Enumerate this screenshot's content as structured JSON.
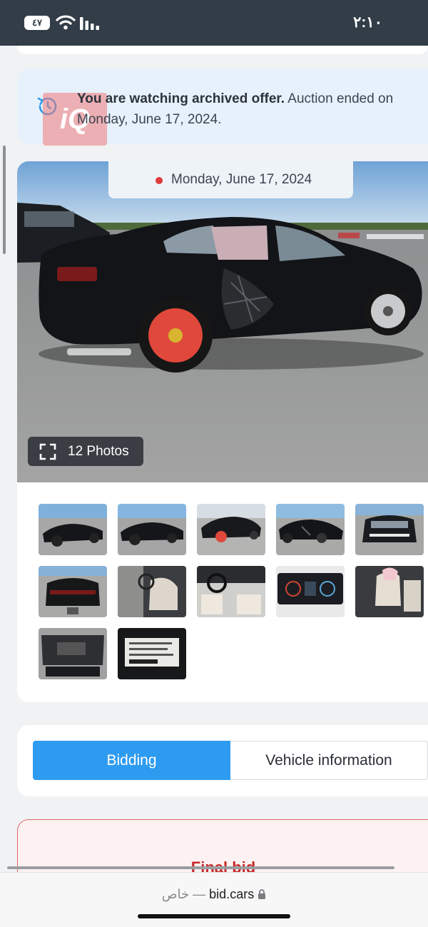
{
  "status_bar": {
    "time": "٢:١٠",
    "battery": "٤٧"
  },
  "notice": {
    "bold_text": "You are watching archived offer.",
    "text": " Auction ended on Monday, June 17, 2024.",
    "watermark": "iQ"
  },
  "gallery": {
    "date_label": "Monday, June 17, 2024",
    "photos_button_label": "12 Photos",
    "thumbnails": [
      {
        "name": "thumb-side-left"
      },
      {
        "name": "thumb-side-left-2"
      },
      {
        "name": "thumb-rear-spare"
      },
      {
        "name": "thumb-damage-side"
      },
      {
        "name": "thumb-front"
      },
      {
        "name": "thumb-rear"
      },
      {
        "name": "thumb-driver-door-interior"
      },
      {
        "name": "thumb-dashboard"
      },
      {
        "name": "thumb-instrument-cluster"
      },
      {
        "name": "thumb-rear-seats-airbag"
      },
      {
        "name": "thumb-engine-bay"
      },
      {
        "name": "thumb-vin-label"
      }
    ]
  },
  "tabs": {
    "bidding": "Bidding",
    "vehicle_information": "Vehicle information"
  },
  "bid": {
    "title": "Final bid"
  },
  "browser": {
    "private_label": "خاص —",
    "domain": "bid.cars"
  },
  "colors": {
    "accent_blue": "#2d9bf0",
    "notice_bg": "#e6f1fb",
    "bid_red": "#c62828",
    "status_bar": "#333d47"
  }
}
